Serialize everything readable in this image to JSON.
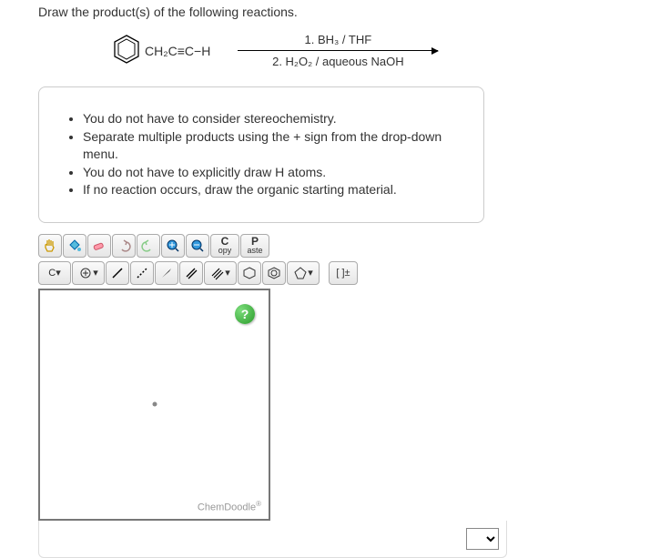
{
  "question": "Draw the product(s) of the following reactions.",
  "reactant": "CH₂C≡C−H",
  "reagent_top": "1. BH₃ / THF",
  "reagent_bottom": "2. H₂O₂ / aqueous NaOH",
  "instructions": [
    "You do not have to consider stereochemistry.",
    "Separate multiple products using the + sign from the drop-down menu.",
    "You do not have to explicitly draw H atoms.",
    "If no reaction occurs, draw the organic starting material."
  ],
  "toolbar": {
    "copy_top": "C",
    "copy_bottom": "opy",
    "paste_top": "P",
    "paste_bottom": "aste",
    "atom_label": "C",
    "charge_label": "[ ]±"
  },
  "help_icon": "?",
  "watermark": "ChemDoodle",
  "watermark_sup": "®"
}
